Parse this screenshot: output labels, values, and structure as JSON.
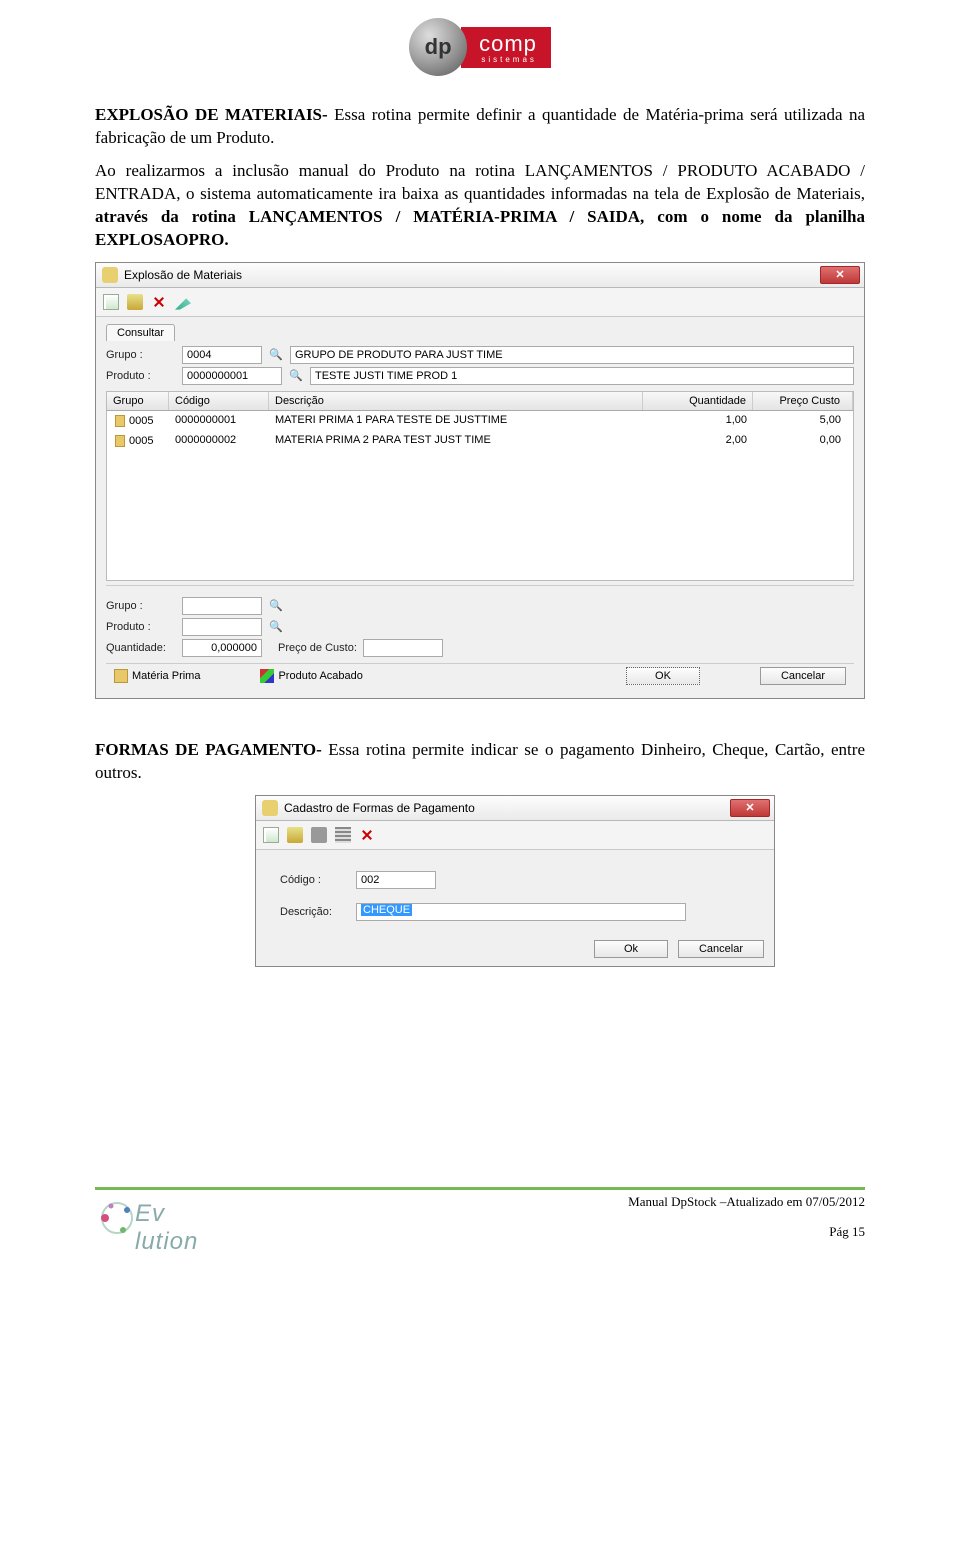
{
  "header": {
    "brand_dp": "dp",
    "brand_comp": "comp",
    "brand_sub": "sistemas"
  },
  "para1": {
    "title": "EXPLOSÃO DE MATERIAIS-",
    "rest": " Essa rotina permite definir a quantidade de Matéria-prima será utilizada na fabricação de um Produto."
  },
  "para2": {
    "lead": "Ao realizarmos a inclusão manual do Produto na rotina LANÇAMENTOS / PRODUTO ACABADO / ENTRADA, o sistema automaticamente ira baixa as quantidades informadas na tela de Explosão de Materiais, ",
    "bold1": "através da rotina LANÇAMENTOS / MATÉRIA-PRIMA / SAIDA, com o nome da planilha EXPLOSAOPRO."
  },
  "win1": {
    "title": "Explosão de Materiais",
    "tab": "Consultar",
    "labels": {
      "grupo": "Grupo :",
      "produto": "Produto :",
      "quantidade": "Quantidade:",
      "preco": "Preço de Custo:"
    },
    "top": {
      "grupo_code": "0004",
      "grupo_desc": "GRUPO DE PRODUTO PARA JUST TIME",
      "produto_code": "0000000001",
      "produto_desc": "TESTE JUSTI TIME PROD 1"
    },
    "grid": {
      "headers": {
        "grupo": "Grupo",
        "codigo": "Código",
        "descricao": "Descrição",
        "quantidade": "Quantidade",
        "preco": "Preço Custo"
      },
      "rows": [
        {
          "grupo": "0005",
          "codigo": "0000000001",
          "descricao": "MATERI PRIMA 1 PARA TESTE DE JUSTTIME",
          "quantidade": "1,00",
          "preco": "5,00"
        },
        {
          "grupo": "0005",
          "codigo": "0000000002",
          "descricao": "MATERIA PRIMA 2 PARA TEST JUST TIME",
          "quantidade": "2,00",
          "preco": "0,00"
        }
      ]
    },
    "lower": {
      "grupo": "",
      "produto": "",
      "quantidade": "0,000000",
      "preco": ""
    },
    "legend": {
      "mp": "Matéria Prima",
      "pa": "Produto Acabado"
    },
    "buttons": {
      "ok": "OK",
      "cancel": "Cancelar"
    }
  },
  "para3": {
    "title": "FORMAS DE PAGAMENTO-",
    "rest": " Essa rotina permite indicar se o pagamento Dinheiro, Cheque, Cartão, entre outros."
  },
  "win2": {
    "title": "Cadastro de Formas de Pagamento",
    "labels": {
      "codigo": "Código :",
      "descricao": "Descrição:"
    },
    "codigo": "002",
    "descricao": "CHEQUE",
    "buttons": {
      "ok": "Ok",
      "cancel": "Cancelar"
    }
  },
  "footer": {
    "ev": "Ev   lution",
    "line1": "Manual DpStock –Atualizado em 07/05/2012",
    "line2": "Pág 15"
  }
}
